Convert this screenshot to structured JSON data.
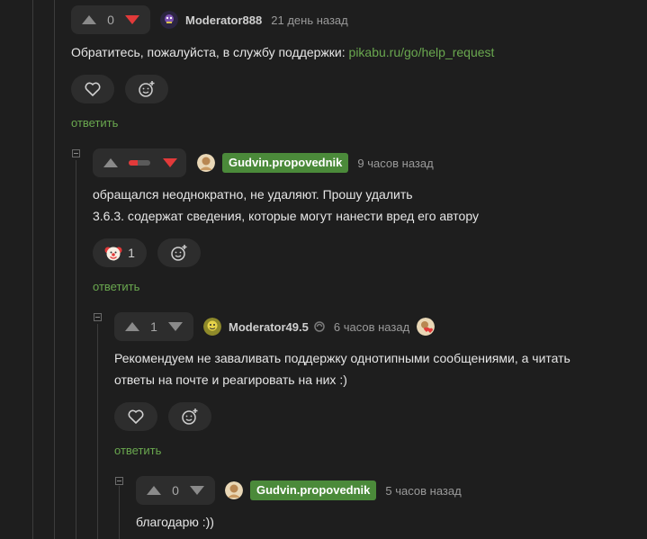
{
  "comments": [
    {
      "rating": "0",
      "author": "Moderator888",
      "time": "21 день назад",
      "text": "Обратитесь, пожалуйста, в службу поддержки: ",
      "link": "pikabu.ru/go/help_request",
      "reply": "ответить"
    },
    {
      "author": "Gudvin.propovednik",
      "time": "9 часов назад",
      "text_lines": [
        "обращался неоднократно, не удаляют. Прошу удалить",
        "3.6.3. содержат сведения, которые могут нанести вред его автору"
      ],
      "reaction_count": "1",
      "reply": "ответить"
    },
    {
      "rating": "1",
      "author": "Moderator49.5",
      "time": "6 часов назад",
      "text_lines": [
        "Рекомендуем не заваливать поддержку однотипными сообщениями, а читать",
        "ответы на почте и реагировать на них :)"
      ],
      "reply": "ответить"
    },
    {
      "rating": "0",
      "author": "Gudvin.propovednik",
      "time": "5 часов назад",
      "text_lines": [
        "благодарю :))"
      ]
    }
  ],
  "colors": {
    "accent": "#6aa84f",
    "badge": "#4b8a3a",
    "downvote": "#e23a3a",
    "background": "#1e1e1e"
  },
  "icons": [
    "arrow-up-icon",
    "arrow-down-icon",
    "heart-icon",
    "add-reaction-icon",
    "clown-emoji-icon",
    "verified-icon",
    "collapse-icon"
  ]
}
